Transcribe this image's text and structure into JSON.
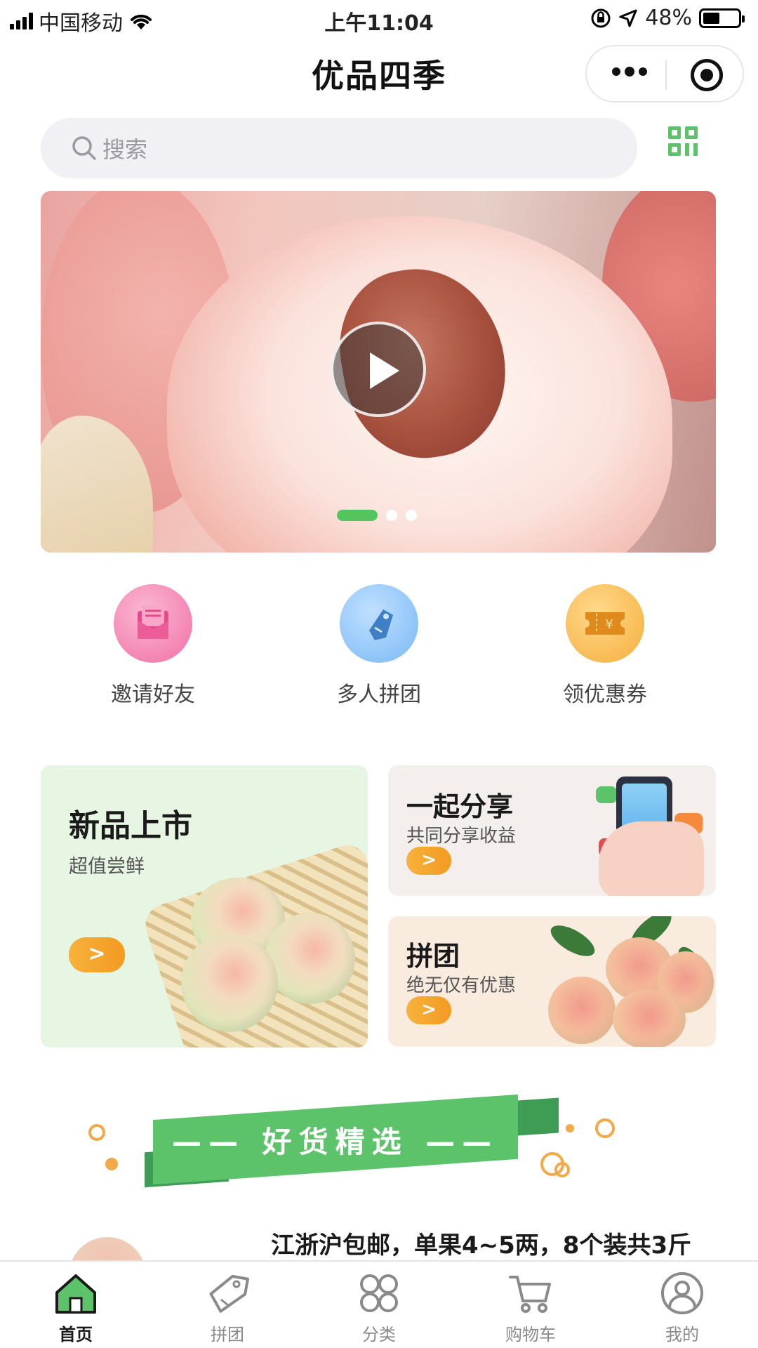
{
  "status_bar": {
    "carrier": "中国移动",
    "time": "上午11:04",
    "battery": "48%",
    "battery_level": 0.48
  },
  "nav": {
    "title": "优品四季"
  },
  "search": {
    "placeholder": "搜索",
    "icons": [
      "search-icon",
      "qr-grid-icon"
    ]
  },
  "banner": {
    "slide_count": 3,
    "active_slide": 1,
    "icon": "play-icon"
  },
  "quick_actions": [
    {
      "label": "邀请好友",
      "icon": "envelope-icon",
      "color": "#f06fa5"
    },
    {
      "label": "多人拼团",
      "icon": "tag-icon",
      "color": "#7ab8f5"
    },
    {
      "label": "领优惠券",
      "icon": "coupon-icon",
      "color": "#f5ae3d"
    }
  ],
  "promos": {
    "new_arrivals": {
      "title": "新品上市",
      "subtitle": "超值尝鲜",
      "arrow": ">"
    },
    "share": {
      "title": "一起分享",
      "subtitle": "共同分享收益",
      "arrow": ">"
    },
    "group": {
      "title": "拼团",
      "subtitle": "绝无仅有优惠",
      "arrow": ">"
    }
  },
  "section": {
    "title": "—— 好货精选 ——"
  },
  "product": {
    "title": "江浙沪包邮，单果4~5两，8个装共3斤"
  },
  "tabs": [
    {
      "label": "首页",
      "icon": "home-icon",
      "active": true
    },
    {
      "label": "拼团",
      "icon": "tag-icon",
      "active": false
    },
    {
      "label": "分类",
      "icon": "category-icon",
      "active": false
    },
    {
      "label": "购物车",
      "icon": "cart-icon",
      "active": false
    },
    {
      "label": "我的",
      "icon": "user-icon",
      "active": false
    }
  ],
  "colors": {
    "brand_green": "#54c45e",
    "accent_orange": "#f39a22"
  }
}
